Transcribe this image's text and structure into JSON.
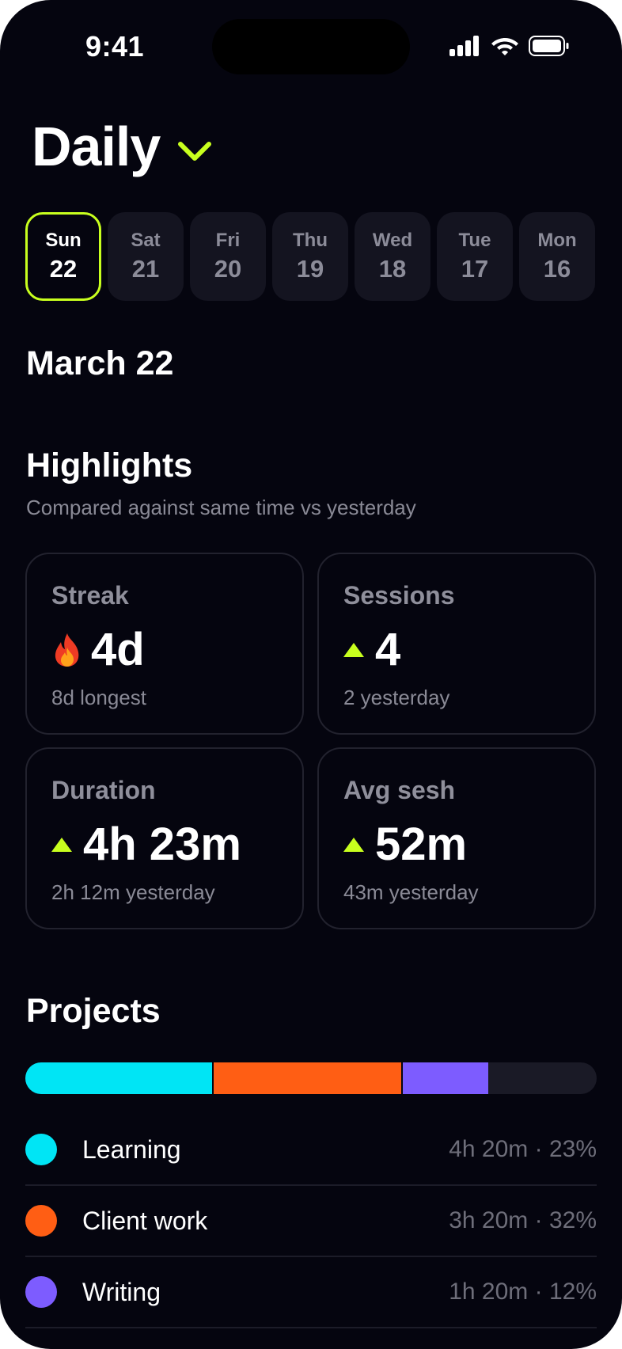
{
  "status": {
    "time": "9:41"
  },
  "header": {
    "title": "Daily"
  },
  "days": [
    {
      "name": "Sun",
      "num": "22",
      "selected": true
    },
    {
      "name": "Sat",
      "num": "21",
      "selected": false
    },
    {
      "name": "Fri",
      "num": "20",
      "selected": false
    },
    {
      "name": "Thu",
      "num": "19",
      "selected": false
    },
    {
      "name": "Wed",
      "num": "18",
      "selected": false
    },
    {
      "name": "Tue",
      "num": "17",
      "selected": false
    },
    {
      "name": "Mon",
      "num": "16",
      "selected": false
    }
  ],
  "date_heading": "March 22",
  "highlights": {
    "title": "Highlights",
    "subtitle": "Compared against same time vs yesterday",
    "cards": [
      {
        "label": "Streak",
        "value": "4d",
        "sub": "8d longest",
        "icon": "flame-icon"
      },
      {
        "label": "Sessions",
        "value": "4",
        "sub": "2 yesterday",
        "icon": "up-arrow-icon"
      },
      {
        "label": "Duration",
        "value": "4h 23m",
        "sub": "2h 12m yesterday",
        "icon": "up-arrow-icon"
      },
      {
        "label": "Avg sesh",
        "value": "52m",
        "sub": "43m yesterday",
        "icon": "up-arrow-icon"
      }
    ]
  },
  "projects": {
    "title": "Projects",
    "bar_segments": [
      {
        "color": "#00e5f5",
        "fraction": 0.33
      },
      {
        "color": "#ff5e14",
        "fraction": 0.33
      },
      {
        "color": "#7d5cff",
        "fraction": 0.15
      }
    ],
    "items": [
      {
        "name": "Learning",
        "time": "4h 20m",
        "percent": "23%",
        "color": "#00e5f5"
      },
      {
        "name": "Client work",
        "time": "3h 20m",
        "percent": "32%",
        "color": "#ff5e14"
      },
      {
        "name": "Writing",
        "time": "1h 20m",
        "percent": "12%",
        "color": "#7d5cff"
      }
    ]
  },
  "colors": {
    "accent": "#c8ff1e",
    "background": "#05050f"
  }
}
